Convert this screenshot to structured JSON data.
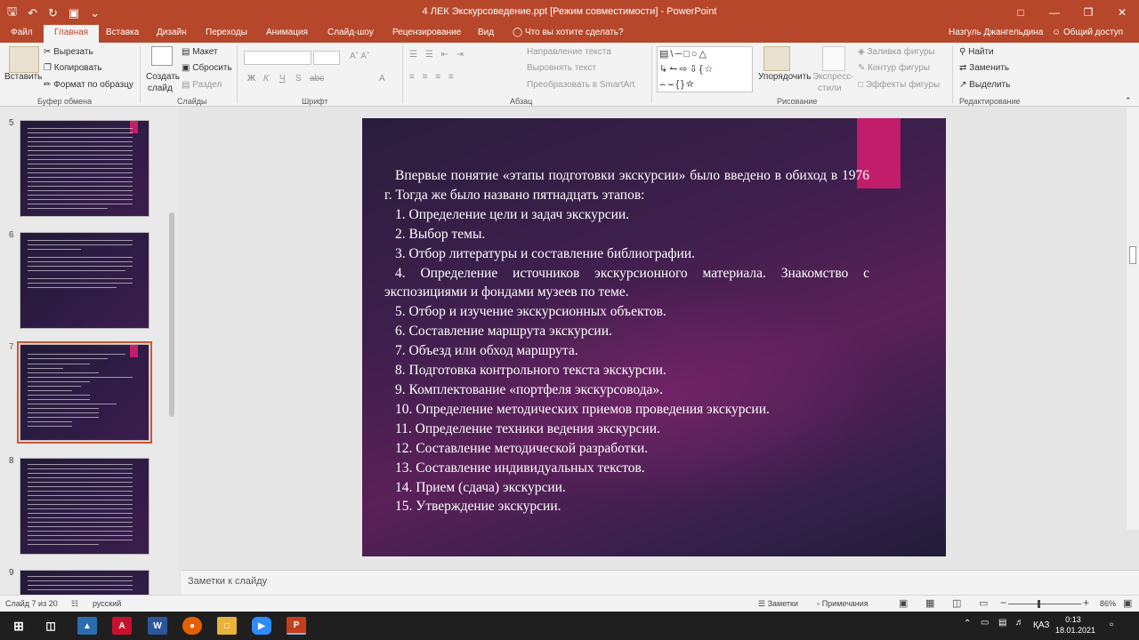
{
  "app": {
    "window_title": "4 ЛЕК Экскурсоведение.ppt [Режим совместимости] - PowerPoint",
    "user": "Назгуль Джангельдина",
    "share": "Общий доступ",
    "search_hint": "Что вы хотите сделать?",
    "accent": "#b7472a"
  },
  "tabs": [
    "Файл",
    "Главная",
    "Вставка",
    "Дизайн",
    "Переходы",
    "Анимация",
    "Слайд-шоу",
    "Рецензирование",
    "Вид"
  ],
  "ribbon": {
    "clipboard": {
      "paste": "Вставить",
      "cut": "Вырезать",
      "copy": "Копировать",
      "format": "Формат по образцу",
      "label": "Буфер обмена"
    },
    "slides": {
      "new_slide_1": "Создать",
      "new_slide_2": "слайд",
      "layout": "Макет",
      "reset": "Сбросить",
      "section": "Раздел",
      "label": "Слайды"
    },
    "font": {
      "label": "Шрифт",
      "bold": "Ж",
      "italic": "К",
      "underline": "Ч",
      "shadow": "S",
      "strike": "abc"
    },
    "paragraph": {
      "text_dir": "Направление текста",
      "align_text": "Выровнять текст",
      "smartart": "Преобразовать в SmartArt",
      "label": "Абзац"
    },
    "drawing": {
      "arrange": "Упорядочить",
      "styles_1": "Экспресс-",
      "styles_2": "стили",
      "fill": "Заливка фигуры",
      "outline": "Контур фигуры",
      "effects": "Эффекты фигуры",
      "label": "Рисование"
    },
    "editing": {
      "find": "Найти",
      "replace": "Заменить",
      "select": "Выделить",
      "label": "Редактирование"
    }
  },
  "thumbnails": [
    {
      "num": "5"
    },
    {
      "num": "6"
    },
    {
      "num": "7"
    },
    {
      "num": "8"
    },
    {
      "num": "9"
    }
  ],
  "slide": {
    "intro": "Впервые понятие «этапы подготовки экскурсии» было введено в обиход в 1976 г. Тогда же было названо пятнадцать этапов:",
    "items": [
      "1. Определение цели и задач экскурсии.",
      "2. Выбор темы.",
      "3. Отбор литературы и составление библиографии.",
      "4. Определение источников экскурсионного материала. Знакомство с экспозициями и фондами музеев по теме.",
      "5. Отбор и изучение экскурсионных объектов.",
      "6. Составление маршрута экскурсии.",
      "7. Объезд или обход маршрута.",
      "8. Подготовка контрольного текста экскурсии.",
      "9. Комплектование «портфеля экскурсовода».",
      "10. Определение методических приемов проведения экскурсии.",
      "11. Определение техники ведения экскурсии.",
      "12. Составление методической разработки.",
      "13. Составление индивидуальных текстов.",
      "14. Прием (сдача) экскурсии.",
      "15. Утверждение экскурсии."
    ]
  },
  "notes_placeholder": "Заметки к слайду",
  "status": {
    "slide_info": "Слайд 7 из 20",
    "language": "русский",
    "notes": "Заметки",
    "comments": "Примечания",
    "zoom": "86%"
  },
  "taskbar": {
    "lang": "ҚАЗ",
    "time": "0:13",
    "date": "18.01.2021"
  }
}
